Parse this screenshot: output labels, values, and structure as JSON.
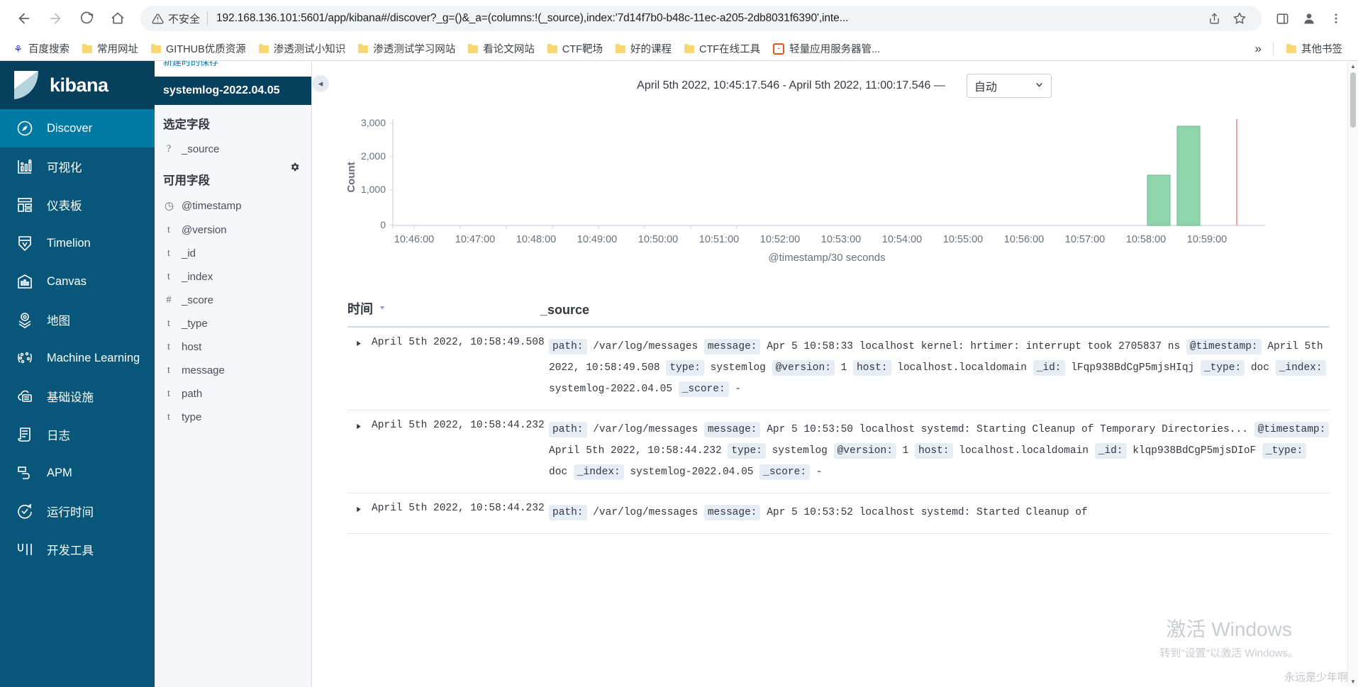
{
  "browser": {
    "back_icon": "back-arrow-icon",
    "forward_icon": "forward-arrow-icon",
    "reload_icon": "reload-icon",
    "home_icon": "home-icon",
    "insecure_label": "不安全",
    "url": "192.168.136.101:5601/app/kibana#/discover?_g=()&_a=(columns:!(_source),index:'7d14f7b0-b48c-11ec-a205-2db8031f6390',inte...",
    "share_icon": "share-icon",
    "star_icon": "bookmark-star-icon",
    "sidepanel_icon": "side-panel-icon",
    "profile_icon": "profile-avatar-icon",
    "menu_icon": "three-dot-menu-icon"
  },
  "bookmarks": {
    "items": [
      {
        "label": "百度搜索",
        "icon": "baidu-icon"
      },
      {
        "label": "常用网址",
        "icon": "folder-icon"
      },
      {
        "label": "GITHUB优质资源",
        "icon": "folder-icon"
      },
      {
        "label": "渗透测试小知识",
        "icon": "folder-icon"
      },
      {
        "label": "渗透测试学习网站",
        "icon": "folder-icon"
      },
      {
        "label": "看论文网站",
        "icon": "folder-icon"
      },
      {
        "label": "CTF靶场",
        "icon": "folder-icon"
      },
      {
        "label": "好的课程",
        "icon": "folder-icon"
      },
      {
        "label": "CTF在线工具",
        "icon": "folder-icon"
      },
      {
        "label": "轻量应用服务器管...",
        "icon": "orange-bracket-icon"
      }
    ],
    "overflow_label": "»",
    "other_label": "其他书签"
  },
  "kibana_nav": {
    "brand": "kibana",
    "items": [
      {
        "label": "Discover",
        "icon": "compass-icon",
        "active": true
      },
      {
        "label": "可视化",
        "icon": "visualize-chart-icon",
        "active": false
      },
      {
        "label": "仪表板",
        "icon": "dashboard-grid-icon",
        "active": false
      },
      {
        "label": "Timelion",
        "icon": "timelion-icon",
        "active": false
      },
      {
        "label": "Canvas",
        "icon": "canvas-icon",
        "active": false
      },
      {
        "label": "地图",
        "icon": "map-pin-layers-icon",
        "active": false
      },
      {
        "label": "Machine Learning",
        "icon": "machine-learning-icon",
        "active": false
      },
      {
        "label": "基础设施",
        "icon": "infrastructure-cloud-icon",
        "active": false
      },
      {
        "label": "日志",
        "icon": "logs-scroll-icon",
        "active": false
      },
      {
        "label": "APM",
        "icon": "apm-icon",
        "active": false
      },
      {
        "label": "运行时间",
        "icon": "uptime-icon",
        "active": false
      },
      {
        "label": "开发工具",
        "icon": "dev-tools-icon",
        "active": false
      }
    ]
  },
  "fields_panel": {
    "partial_top_label": "新建时的保存",
    "index_pattern": "systemlog-2022.04.05",
    "selected_title": "选定字段",
    "selected_fields": [
      {
        "type": "?",
        "name": "_source"
      }
    ],
    "available_title": "可用字段",
    "settings_icon": "gear-icon",
    "available_fields": [
      {
        "type": "◷",
        "name": "@timestamp"
      },
      {
        "type": "t",
        "name": "@version"
      },
      {
        "type": "t",
        "name": "_id"
      },
      {
        "type": "t",
        "name": "_index"
      },
      {
        "type": "#",
        "name": "_score"
      },
      {
        "type": "t",
        "name": "_type"
      },
      {
        "type": "t",
        "name": "host"
      },
      {
        "type": "t",
        "name": "message"
      },
      {
        "type": "t",
        "name": "path"
      },
      {
        "type": "t",
        "name": "type"
      }
    ],
    "collapse_icon": "collapse-left-icon"
  },
  "toolbar": {
    "time_range": "April 5th 2022, 10:45:17.546 - April 5th 2022, 11:00:17.546  —",
    "interval_value": "自动",
    "interval_caret": "▾"
  },
  "chart_data": {
    "type": "bar",
    "title": "",
    "xlabel": "@timestamp/30 seconds",
    "ylabel": "Count",
    "ylim": [
      0,
      3400
    ],
    "yticks": [
      0,
      1000,
      2000,
      3000
    ],
    "ytick_labels": [
      "0",
      "1,000",
      "2,000",
      "3,000"
    ],
    "xticks": [
      "10:46:00",
      "10:47:00",
      "10:48:00",
      "10:49:00",
      "10:50:00",
      "10:51:00",
      "10:52:00",
      "10:53:00",
      "10:54:00",
      "10:55:00",
      "10:56:00",
      "10:57:00",
      "10:58:00",
      "10:59:00"
    ],
    "grid": false,
    "legend": "none",
    "bar_color": "#8fd4ab",
    "bar_stroke": "#6bbd8c",
    "categories": [
      "10:58:00",
      "10:58:30"
    ],
    "values": [
      1600,
      3200
    ],
    "series": [
      {
        "name": "Count",
        "values": [
          1600,
          3200
        ]
      }
    ]
  },
  "doc_table": {
    "columns": [
      "时间",
      "_source"
    ],
    "sort_caret": "▾",
    "expand_icon": "expand-row-triangle-icon",
    "rows": [
      {
        "time": "April 5th 2022, 10:58:49.508",
        "fields": [
          {
            "key": "path:",
            "value": "/var/log/messages"
          },
          {
            "key": "message:",
            "value": "Apr 5 10:58:33 localhost kernel: hrtimer: interrupt took 2705837 ns"
          },
          {
            "key": "@timestamp:",
            "value": "April 5th 2022, 10:58:49.508"
          },
          {
            "key": "type:",
            "value": "systemlog"
          },
          {
            "key": "@version:",
            "value": "1"
          },
          {
            "key": "host:",
            "value": "localhost.localdomain"
          },
          {
            "key": "_id:",
            "value": "lFqp938BdCgP5mjsHIqj"
          },
          {
            "key": "_type:",
            "value": "doc"
          },
          {
            "key": "_index:",
            "value": "systemlog-2022.04.05"
          },
          {
            "key": "_score:",
            "value": "-"
          }
        ]
      },
      {
        "time": "April 5th 2022, 10:58:44.232",
        "fields": [
          {
            "key": "path:",
            "value": "/var/log/messages"
          },
          {
            "key": "message:",
            "value": "Apr 5 10:53:50 localhost systemd: Starting Cleanup of Temporary Directories..."
          },
          {
            "key": "@timestamp:",
            "value": "April 5th 2022, 10:58:44.232"
          },
          {
            "key": "type:",
            "value": "systemlog"
          },
          {
            "key": "@version:",
            "value": "1"
          },
          {
            "key": "host:",
            "value": "localhost.localdomain"
          },
          {
            "key": "_id:",
            "value": "klqp938BdCgP5mjsDIoF"
          },
          {
            "key": "_type:",
            "value": "doc"
          },
          {
            "key": "_index:",
            "value": "systemlog-2022.04.05"
          },
          {
            "key": "_score:",
            "value": "-"
          }
        ]
      },
      {
        "time": "April 5th 2022, 10:58:44.232",
        "fields": [
          {
            "key": "path:",
            "value": "/var/log/messages"
          },
          {
            "key": "message:",
            "value": "Apr 5 10:53:52 localhost systemd: Started Cleanup of"
          }
        ]
      }
    ]
  },
  "watermark": {
    "line1": "激活 Windows",
    "line2": "转到\"设置\"以激活 Windows。",
    "nickname": "永远是少年啊"
  },
  "colors": {
    "nav_bg": "#08577a",
    "nav_active": "#0079a5",
    "logo_bg": "#07405c",
    "bar_fill": "#8fd4ab",
    "field_badge": "#e7edf5"
  }
}
